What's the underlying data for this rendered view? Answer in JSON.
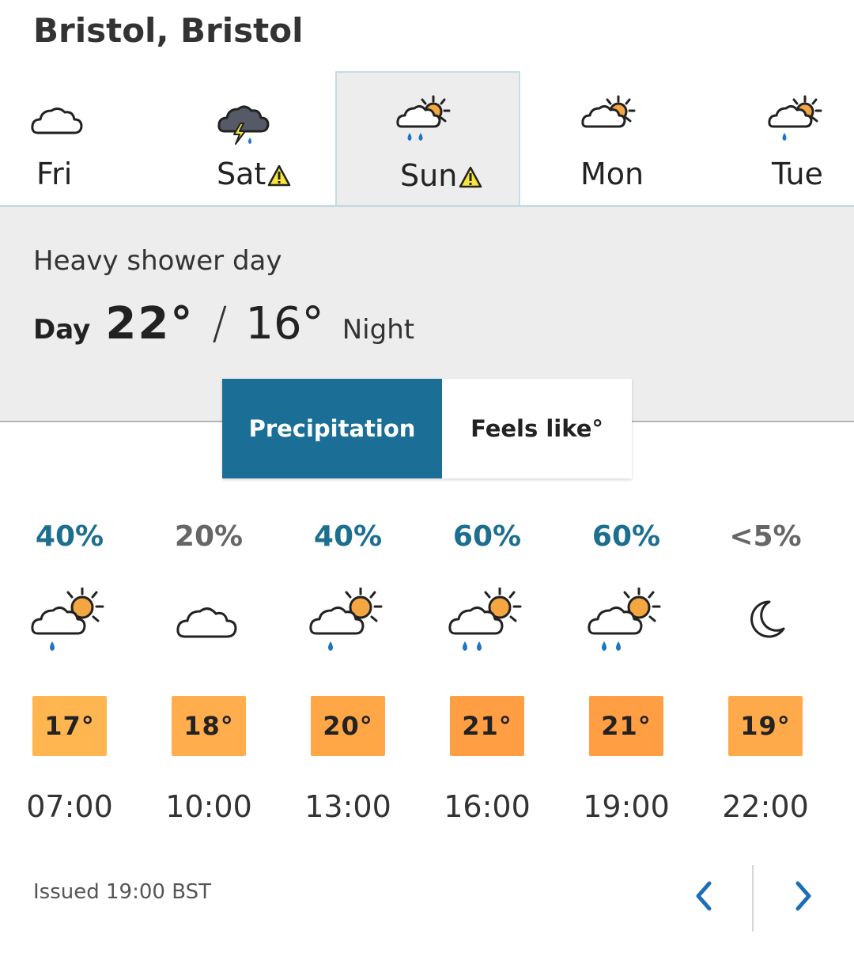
{
  "location": "Bristol, Bristol",
  "days": [
    {
      "name": "Fri",
      "icon": "cloud-icon",
      "warning": false,
      "active": false
    },
    {
      "name": "Sat",
      "icon": "thunder-rain-icon",
      "warning": true,
      "active": false
    },
    {
      "name": "Sun",
      "icon": "sun-cloud-heavy-rain-icon",
      "warning": true,
      "active": true
    },
    {
      "name": "Mon",
      "icon": "sun-cloud-icon",
      "warning": false,
      "active": false
    },
    {
      "name": "Tue",
      "icon": "sun-cloud-light-rain-icon",
      "warning": false,
      "active": false
    }
  ],
  "summary": {
    "description": "Heavy shower day",
    "day_label": "Day",
    "day_temp": "22°",
    "slash": "/",
    "night_temp": "16°",
    "night_label": "Night"
  },
  "toggle": {
    "precipitation_label": "Precipitation",
    "feels_like_label": "Feels like°",
    "selected": "Precipitation"
  },
  "hourly": [
    {
      "pct": "40%",
      "icon": "sun-cloud-light-rain-icon",
      "temp": "17°",
      "time": "07:00"
    },
    {
      "pct": "20%",
      "icon": "cloud-icon",
      "temp": "18°",
      "time": "10:00"
    },
    {
      "pct": "40%",
      "icon": "sun-cloud-light-rain-icon",
      "temp": "20°",
      "time": "13:00"
    },
    {
      "pct": "60%",
      "icon": "sun-cloud-heavy-rain-icon",
      "temp": "21°",
      "time": "16:00"
    },
    {
      "pct": "60%",
      "icon": "sun-cloud-heavy-rain-icon",
      "temp": "21°",
      "time": "19:00"
    },
    {
      "pct": "<5%",
      "icon": "moon-icon",
      "temp": "19°",
      "time": "22:00"
    }
  ],
  "issued": "Issued 19:00 BST",
  "colors": {
    "accent": "#1b6f96",
    "pct_high": "#1d6f8f",
    "pct_low": "#666666",
    "temp_17": "#ffb550",
    "temp_18": "#ffad4d",
    "temp_20": "#ffa646",
    "temp_21": "#ff9e42",
    "temp_19": "#ffaa4a",
    "warning": "#f7e53c",
    "sun": "#f4a740",
    "rain": "#1f74c4"
  }
}
